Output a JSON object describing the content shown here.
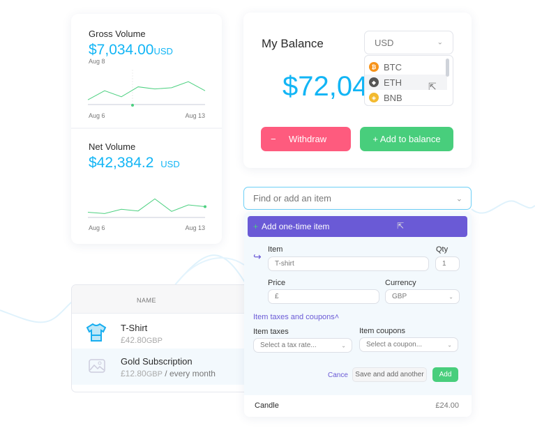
{
  "gross": {
    "title": "Gross Volume",
    "amount": "$7,034.00",
    "currency": "USD",
    "hover_date": "Aug 8",
    "x_start": "Aug 6",
    "x_end": "Aug 13"
  },
  "net": {
    "title": "Net Volume",
    "amount": "$42,384.2",
    "currency": "USD",
    "x_start": "Aug 6",
    "x_end": "Aug 13"
  },
  "chart_data": [
    {
      "type": "line",
      "values": [
        11,
        32,
        18,
        41,
        36,
        39,
        53,
        32
      ],
      "x_start": "Aug 6",
      "x_end": "Aug 13",
      "grid": false,
      "color": "#4cd080"
    },
    {
      "type": "line",
      "values": [
        12,
        9,
        19,
        15,
        43,
        14,
        29,
        25
      ],
      "x_start": "Aug 6",
      "x_end": "Aug 13",
      "grid": false,
      "color": "#4cd080"
    }
  ],
  "balance": {
    "title": "My Balance",
    "amount": "$72,04",
    "currency_selected": "USD",
    "options": [
      {
        "label": "BTC",
        "glyph": "₿",
        "color": "#f7931a"
      },
      {
        "label": "ETH",
        "glyph": "◆",
        "color": "#555555"
      },
      {
        "label": "BNB",
        "glyph": "◈",
        "color": "#f3ba2f"
      }
    ],
    "withdraw_label": "Withdraw",
    "withdraw_icon": "−",
    "add_label": "+ Add to balance"
  },
  "products": {
    "header": "NAME",
    "rows": [
      {
        "name": "T-Shirt",
        "price": "£42.80",
        "currency": "GBP",
        "suffix": ""
      },
      {
        "name": "Gold Subscription",
        "price": "£12.80",
        "currency": "GBP",
        "suffix": "/ every month"
      }
    ]
  },
  "finder": {
    "placeholder": "Find or add an item",
    "add_one_time": "Add one-time item",
    "item_label": "Item",
    "item_value": "T-shirt",
    "qty_label": "Qty",
    "qty_value": "1",
    "price_label": "Price",
    "price_value": "£",
    "currency_label": "Currency",
    "currency_value": "GBP",
    "taxes_toggle": "Item taxes and coupons",
    "taxes_label": "Item taxes",
    "taxes_placeholder": "Select a tax rate...",
    "coupons_label": "Item coupons",
    "coupons_placeholder": "Select a coupon...",
    "cancel": "Cance",
    "save_another": "Save and add another",
    "add": "Add",
    "line_item": {
      "name": "Candle",
      "price": "£24.00"
    }
  }
}
